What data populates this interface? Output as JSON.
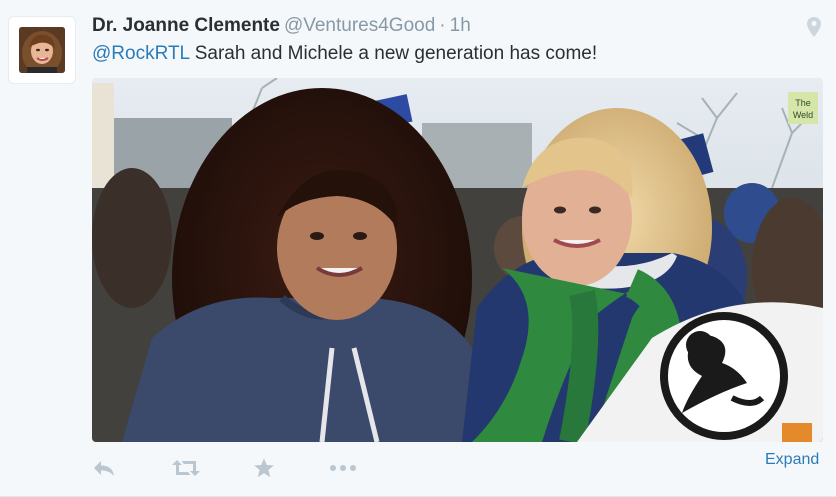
{
  "tweet": {
    "display_name": "Dr. Joanne Clemente",
    "handle": "@Ventures4Good",
    "separator": "·",
    "time": "1h",
    "mention": "@RockRTL",
    "text": " Sarah and Michele a new generation has come!",
    "sign_text": "The\nWeld"
  },
  "actions": {
    "reply_icon": "reply-icon",
    "retweet_icon": "retweet-icon",
    "favorite_icon": "star-icon",
    "more_icon": "more-icon",
    "expand_label": "Expand"
  },
  "colors": {
    "background": "#f5f8fa",
    "name": "#292f33",
    "meta": "#8899a6",
    "link": "#2b7bb9",
    "action_icon": "#bac7d1"
  }
}
